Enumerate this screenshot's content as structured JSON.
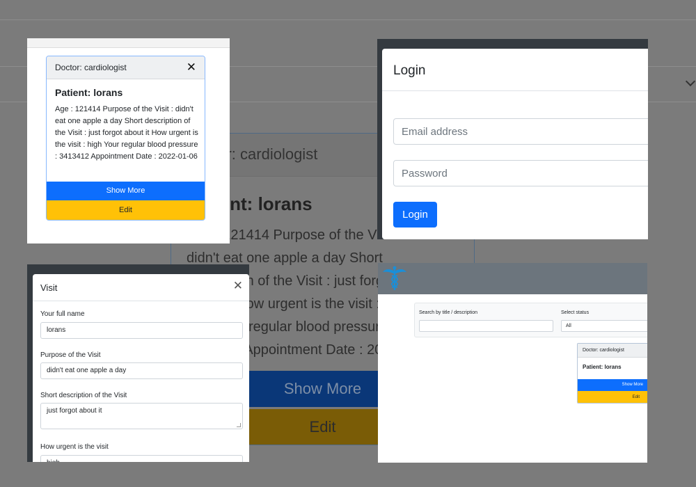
{
  "doctor_card": {
    "header": "Doctor: cardiologist",
    "patient_title": "Patient: lorans",
    "details": "Age : 121414 Purpose of the Visit : didn't eat one apple a day Short description of the Visit : just forgot about it How urgent is the visit : high Your regular blood pressure : 3413412 Appointment Date : 2022-01-06",
    "show_more_label": "Show More",
    "edit_label": "Edit",
    "close_glyph": "✕"
  },
  "background_card": {
    "header": "Doctor: cardiologist",
    "patient_title": "Patient: lorans",
    "details": "Age : 121414 Purpose of the Visit : didn't eat one apple a day Short description of the Visit : just forgot about it How urgent is the visit : high Your regular blood pressure : 3413412 Appointment Date : 2022-01-06",
    "show_more_label": "Show More",
    "edit_label": "Edit"
  },
  "login": {
    "title": "Login",
    "email_placeholder": "Email address",
    "password_placeholder": "Password",
    "button_label": "Login"
  },
  "visit_form": {
    "title": "Visit",
    "close_glyph": "✕",
    "fields": [
      {
        "label": "Your full name",
        "value": "lorans"
      },
      {
        "label": "Purpose of the Visit",
        "value": "didn't eat one apple a day"
      },
      {
        "label": "Short description of the Visit",
        "value": "just forgot about it"
      },
      {
        "label": "How urgent is the visit",
        "value": "high"
      }
    ]
  },
  "dashboard": {
    "logo_icon": "caduceus-icon",
    "search_label": "Search by title / description",
    "search_value": "",
    "status_label": "Select status",
    "status_value": "All",
    "card": {
      "header": "Doctor: cardiologist",
      "patient_title": "Patient: lorans",
      "show_more_label": "Show More",
      "edit_label": "Edit"
    }
  },
  "colors": {
    "primary": "#0d6efd",
    "warning": "#ffc107",
    "navbar_dark": "#343a40",
    "navbar_gray": "#6c757d",
    "overlay": "#7b7b7b"
  }
}
